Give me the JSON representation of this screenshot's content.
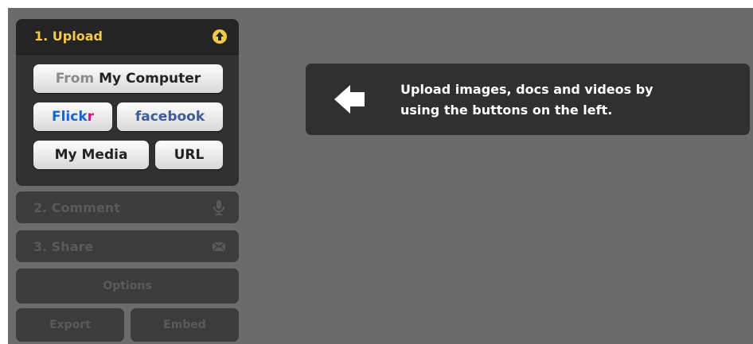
{
  "upload": {
    "title": "1. Upload",
    "icon": "upload-arrow-icon",
    "from_muted": "From",
    "from_label": "My Computer",
    "flickr_a": "Flick",
    "flickr_b": "r",
    "facebook_label": "facebook",
    "mymedia_label": "My Media",
    "url_label": "URL"
  },
  "steps": {
    "comment": "2. Comment",
    "comment_icon": "microphone-icon",
    "share": "3. Share",
    "share_icon": "envelope-icon"
  },
  "footer": {
    "options": "Options",
    "export": "Export",
    "embed": "Embed"
  },
  "hint": {
    "line1": "Upload images, docs and videos by",
    "line2": "using the buttons on the left.",
    "icon": "left-arrow-icon"
  },
  "colors": {
    "accent": "#f2c94c",
    "flickr_blue": "#1466d0",
    "flickr_pink": "#ff0084",
    "facebook_blue": "#3d5c99"
  }
}
